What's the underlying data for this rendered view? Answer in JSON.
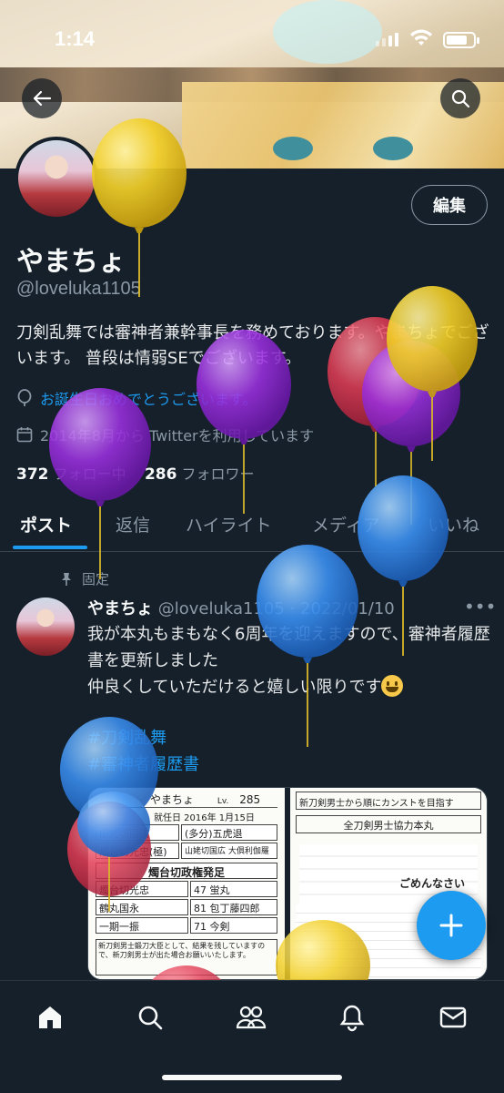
{
  "status_bar": {
    "time": "1:14"
  },
  "profile": {
    "edit_label": "編集",
    "name": "やまちょ",
    "handle": "@loveluka1105",
    "bio": "刀剣乱舞では審神者兼幹事長を務めております。やまちょでございます。 普段は情弱SEでございます。",
    "birthday": "お誕生日おめでとうございます。",
    "joined": "2014年8月から Twitterを利用しています",
    "following_count": "372",
    "following_label": "フォロー中",
    "followers_count": "286",
    "followers_label": "フォロワー"
  },
  "tabs": [
    "ポスト",
    "返信",
    "ハイライト",
    "メディア",
    "いいね"
  ],
  "pinned_label": "固定",
  "tweet": {
    "name": "やまちょ",
    "handle_date": "@loveluka1105 · 2022/01/10",
    "line1": "我が本丸もまもなく6周年を迎えますので、審神者履歴書を更新しました",
    "line2": "仲良くしていただけると嬉しい限りです",
    "hashtag1": "#刀剣乱舞",
    "hashtag2": "#審神者履歴書"
  },
  "media": {
    "left_name": "やまちょ",
    "left_level_label": "Lv.",
    "left_level": "285",
    "left_date": "就任日 2016年 1月15日",
    "left_rows": [
      "山姥切国広",
      "(多分)五虎退",
      "燭台切光忠(極)",
      "山姥切国広 大俱利伽羅",
      "燭台切政権発足",
      "燭台切光忠",
      "47 蛍丸",
      "鶴丸国永",
      "81 包丁藤四郎",
      "一期一振",
      "71 今剣"
    ],
    "left_note": "新刀剣男士鍛刀大臣として、結果を残していますので、新刀剣男士が出た場合お願いいたします。",
    "right_title": "新刀剣男士から順にカンストを目指す",
    "right_policy": "全刀剣男士協力本丸",
    "right_sorry": "ごめんなさい"
  },
  "colors": {
    "accent": "#1d9bf0",
    "background": "#15202b",
    "muted": "#8b98a5"
  },
  "nav_icons": [
    "home-icon",
    "search-icon",
    "communities-icon",
    "notifications-icon",
    "messages-icon"
  ]
}
